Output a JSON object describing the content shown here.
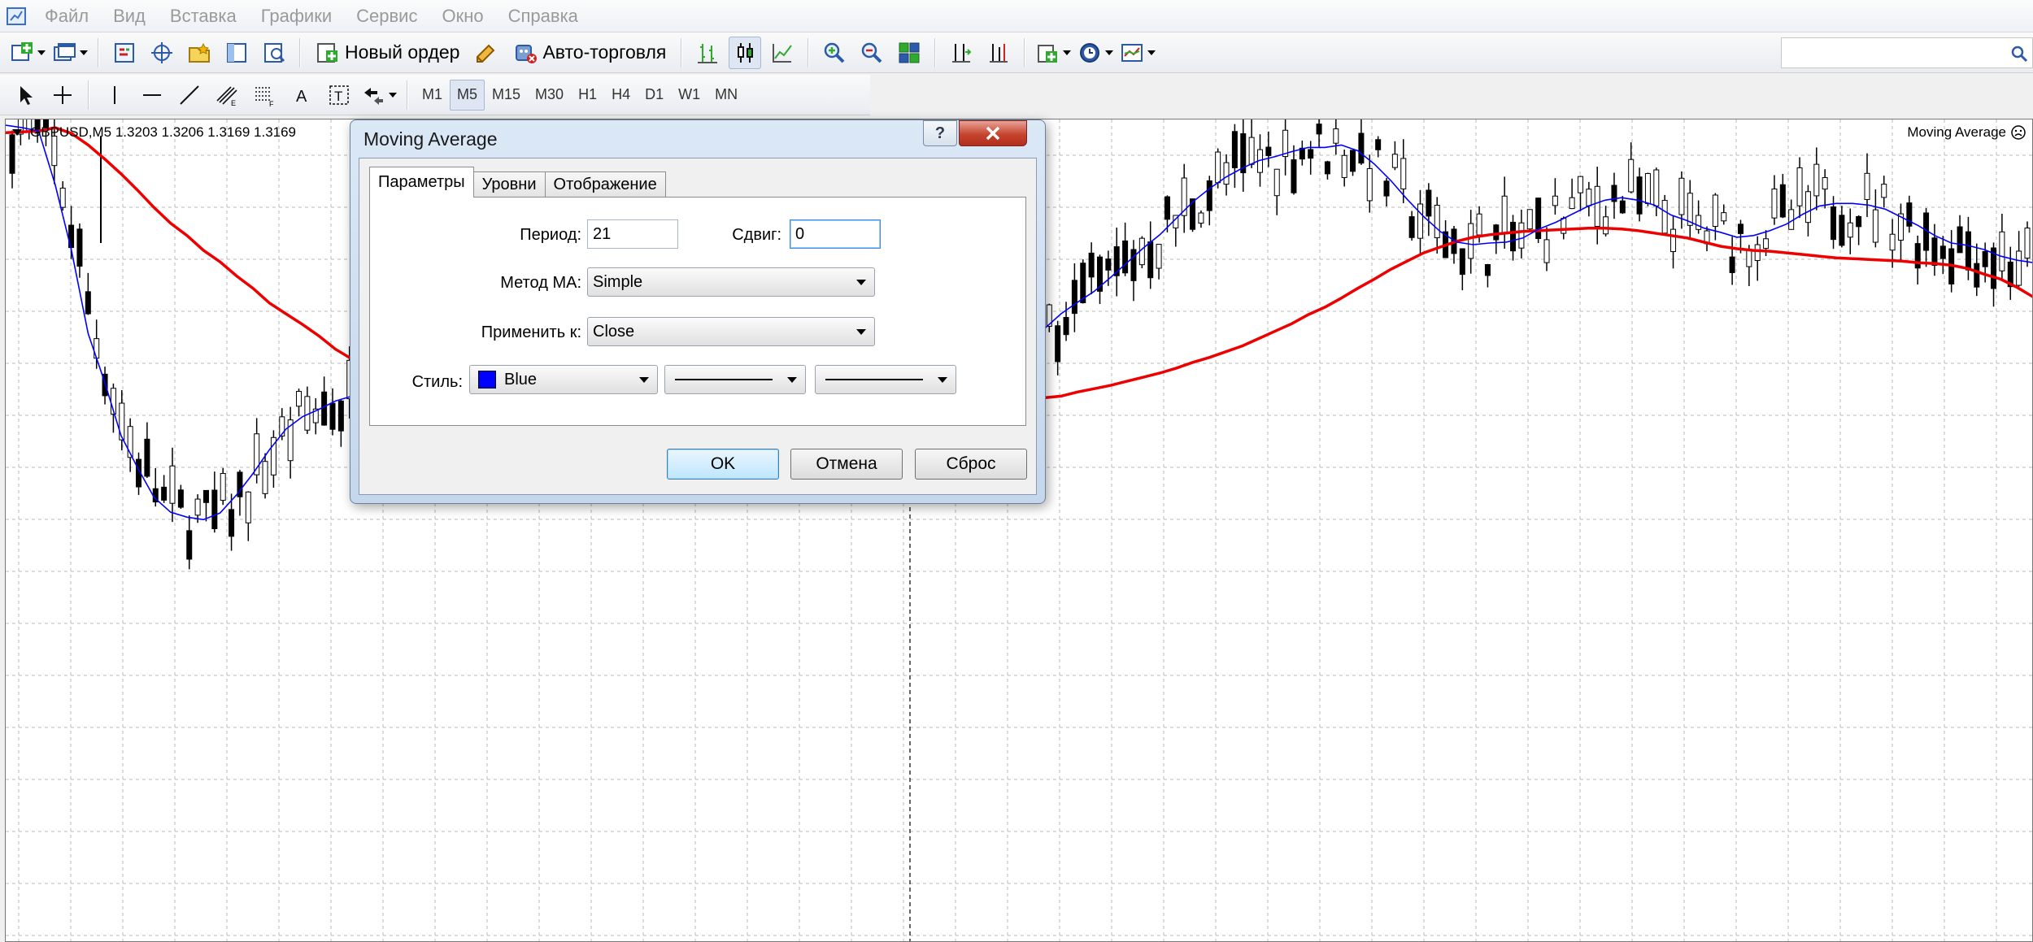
{
  "menu": [
    "Файл",
    "Вид",
    "Вставка",
    "Графики",
    "Сервис",
    "Окно",
    "Справка"
  ],
  "toolbar": {
    "new_order_label": "Новый ордер",
    "autotrading_label": "Авто-торговля",
    "search_placeholder": ""
  },
  "timeframes": [
    "M1",
    "M5",
    "M15",
    "M30",
    "H1",
    "H4",
    "D1",
    "W1",
    "MN"
  ],
  "active_timeframe": "M5",
  "chart": {
    "symbol_info": "GBPUSD,M5  1.3203 1.3206 1.3169 1.3169",
    "indicator_label": "Moving Average",
    "background": "#ffffff",
    "bull_color": "#ffffff",
    "bear_color": "#000000",
    "ma_fast_color": "#0000ff",
    "ma_slow_color": "#ee0000"
  },
  "chart_data": {
    "type": "candlestick",
    "symbol": "GBPUSD",
    "timeframe": "M5",
    "last_ohlc": {
      "open": 1.3203,
      "high": 1.3206,
      "low": 1.3169,
      "close": 1.3169
    },
    "grid": true,
    "series": [
      {
        "values": [
          99.3,
          99.0,
          98.6,
          92.1,
          84.0,
          74.0,
          68.1,
          61.6,
          57.7,
          54.1,
          52.3,
          51.7,
          51.4,
          52.2,
          54.4,
          57.0,
          59.9,
          62.4,
          63.9,
          64.8,
          65.8,
          66.4,
          66.3,
          66.0,
          65.0,
          64.2,
          63.8,
          63.3,
          63.7,
          64.0,
          64.6,
          65.8,
          67.1,
          68.3,
          69.6,
          70.4,
          71.0,
          71.4,
          71.0,
          70.8,
          70.5,
          70.2,
          70.0,
          69.2,
          68.1,
          67.3,
          66.9,
          66.6,
          66.1,
          65.5,
          64.8,
          64.6,
          64.6,
          64.9,
          65.3,
          65.9,
          66.7,
          67.7,
          68.7,
          69.8,
          70.8,
          71.9,
          73.3,
          74.6,
          76.4,
          77.8,
          79.1,
          80.8,
          82.6,
          84.4,
          86.0,
          88.0,
          90.0,
          91.6,
          93.0,
          94.1,
          95.0,
          95.5,
          96.1,
          96.6,
          96.6,
          96.9,
          96.2,
          94.6,
          92.6,
          90.3,
          88.2,
          86.4,
          85.1,
          84.8,
          85.0,
          85.1,
          85.6,
          86.7,
          87.5,
          88.5,
          89.5,
          90.2,
          90.5,
          90.2,
          89.6,
          88.4,
          87.7,
          86.8,
          86.3,
          85.7,
          85.9,
          86.5,
          87.3,
          88.5,
          89.5,
          89.8,
          89.8,
          89.6,
          89.1,
          88.1,
          87.1,
          85.9,
          85.0,
          84.7,
          84.2,
          83.4,
          82.9,
          82.6
        ]
      },
      {
        "values": [
          98.4,
          98.5,
          98.6,
          99.0,
          98.3,
          96.9,
          95.2,
          93.4,
          91.4,
          89.3,
          87.4,
          85.9,
          84.1,
          82.7,
          81.0,
          79.5,
          77.7,
          76.4,
          75.1,
          73.7,
          72.1,
          70.9,
          69.6,
          68.5,
          67.3,
          66.6,
          65.9,
          65.3,
          65.0,
          64.6,
          64.1,
          63.9,
          64.1,
          64.3,
          64.4,
          64.8,
          65.0,
          65.3,
          65.3,
          65.6,
          65.9,
          66.0,
          66.1,
          66.0,
          66.0,
          66.1,
          65.9,
          66.0,
          66.1,
          66.0,
          65.8,
          65.7,
          65.7,
          65.6,
          65.6,
          65.5,
          65.6,
          65.5,
          65.3,
          65.4,
          65.6,
          65.8,
          66.0,
          66.2,
          66.4,
          66.9,
          67.3,
          67.7,
          68.2,
          68.7,
          69.2,
          69.8,
          70.5,
          71.1,
          71.8,
          72.5,
          73.4,
          74.3,
          75.2,
          76.3,
          77.2,
          78.3,
          79.5,
          80.6,
          81.8,
          82.8,
          83.8,
          84.5,
          85.2,
          85.7,
          86.0,
          86.2,
          86.4,
          86.5,
          86.6,
          86.7,
          86.8,
          86.8,
          86.7,
          86.5,
          86.2,
          85.9,
          85.6,
          85.1,
          84.6,
          84.3,
          84.1,
          84.0,
          83.8,
          83.6,
          83.4,
          83.2,
          83.1,
          83.0,
          82.9,
          82.8,
          82.6,
          82.5,
          82.3,
          81.9,
          81.2,
          80.6,
          79.6,
          78.4
        ]
      }
    ]
  },
  "dialog": {
    "title": "Moving Average",
    "help_button": "?",
    "tabs": [
      "Параметры",
      "Уровни",
      "Отображение"
    ],
    "period_label": "Период:",
    "period_value": "21",
    "shift_label": "Сдвиг:",
    "shift_value": "0",
    "method_label": "Метод МА:",
    "method_value": "Simple",
    "apply_label": "Применить к:",
    "apply_value": "Close",
    "style_label": "Стиль:",
    "style_color_name": "Blue",
    "style_color": "#0000ff",
    "ok_label": "OK",
    "cancel_label": "Отмена",
    "reset_label": "Сброс"
  }
}
